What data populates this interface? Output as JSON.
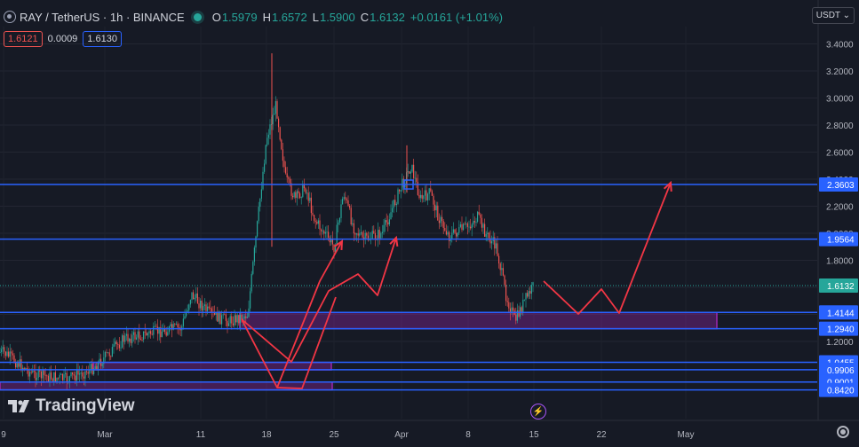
{
  "header": {
    "title": "RAY / TetherUS · 1h · BINANCE",
    "open_label": "O",
    "open": "1.5979",
    "high_label": "H",
    "high": "1.6572",
    "low_label": "L",
    "low": "1.5900",
    "close_label": "C",
    "close": "1.6132",
    "change": "+0.0161 (+1.01%)"
  },
  "trade": {
    "sell": "1.6121",
    "spread": "0.0009",
    "buy": "1.6130"
  },
  "currency": "USDT ⌄",
  "branding": "TradingView",
  "icons": {
    "symbol": "coin-icon",
    "live": "market-open-dot",
    "bolt": "lightning-icon",
    "settings": "gear-icon"
  },
  "colors": {
    "up": "#26a69a",
    "down": "#ef5350",
    "level": "#2962ff",
    "zone": "#9c27b0",
    "arrow": "#f23645",
    "current": "#26a69a"
  },
  "chart_data": {
    "type": "candlestick",
    "y_ticks": [
      "3.4000",
      "3.2000",
      "3.0000",
      "2.8000",
      "2.6000",
      "2.4000",
      "2.2000",
      "2.0000",
      "1.8000",
      "1.6000",
      "1.4000",
      "1.2000"
    ],
    "x_ticks": [
      "9",
      "Mar",
      "11",
      "18",
      "25",
      "Apr",
      "8",
      "15",
      "22",
      "May"
    ],
    "levels": [
      "2.3603",
      "1.9564",
      "1.4144",
      "1.2940",
      "1.0455",
      "0.9906",
      "0.9001",
      "0.8420"
    ],
    "current_price": "1.6132",
    "ylim": [
      0.8,
      3.45
    ],
    "zones": [
      {
        "from_idx": 270,
        "to_idx": 807,
        "low": 1.294,
        "high": 1.4144
      },
      {
        "from_idx": 105,
        "to_idx": 373,
        "low": 0.99,
        "high": 1.045
      },
      {
        "from_idx": 0,
        "to_idx": 374,
        "low": 0.842,
        "high": 0.9
      }
    ],
    "trend": [
      {
        "x": "2024-02-09",
        "y": 1.12
      },
      {
        "x": "2024-02-15",
        "y": 0.96
      },
      {
        "x": "2024-02-22",
        "y": 0.92
      },
      {
        "x": "2024-02-27",
        "y": 0.99
      },
      {
        "x": "2024-03-01",
        "y": 1.08
      },
      {
        "x": "2024-03-03",
        "y": 1.22
      },
      {
        "x": "2024-03-07",
        "y": 1.28
      },
      {
        "x": "2024-03-09",
        "y": 1.3
      },
      {
        "x": "2024-03-10",
        "y": 1.55
      },
      {
        "x": "2024-03-12",
        "y": 1.4
      },
      {
        "x": "2024-03-14",
        "y": 1.35
      },
      {
        "x": "2024-03-16",
        "y": 1.4
      },
      {
        "x": "2024-03-17",
        "y": 2.05
      },
      {
        "x": "2024-03-18",
        "y": 2.7
      },
      {
        "x": "2024-03-19",
        "y": 2.95
      },
      {
        "x": "2024-03-20",
        "y": 2.4
      },
      {
        "x": "2024-03-21",
        "y": 2.25
      },
      {
        "x": "2024-03-22",
        "y": 2.35
      },
      {
        "x": "2024-03-23",
        "y": 2.1
      },
      {
        "x": "2024-03-25",
        "y": 1.9
      },
      {
        "x": "2024-03-26",
        "y": 2.3
      },
      {
        "x": "2024-03-27",
        "y": 2.05
      },
      {
        "x": "2024-03-28",
        "y": 1.95
      },
      {
        "x": "2024-03-30",
        "y": 2.0
      },
      {
        "x": "2024-04-01",
        "y": 2.35
      },
      {
        "x": "2024-04-02",
        "y": 2.5
      },
      {
        "x": "2024-04-03",
        "y": 2.25
      },
      {
        "x": "2024-04-04",
        "y": 2.3
      },
      {
        "x": "2024-04-05",
        "y": 2.1
      },
      {
        "x": "2024-04-06",
        "y": 1.98
      },
      {
        "x": "2024-04-08",
        "y": 2.05
      },
      {
        "x": "2024-04-09",
        "y": 2.12
      },
      {
        "x": "2024-04-10",
        "y": 1.98
      },
      {
        "x": "2024-04-11",
        "y": 1.9
      },
      {
        "x": "2024-04-12",
        "y": 1.55
      },
      {
        "x": "2024-04-13",
        "y": 1.35
      },
      {
        "x": "2024-04-14",
        "y": 1.5
      },
      {
        "x": "2024-04-15",
        "y": 1.61
      }
    ],
    "projection_paths": [
      [
        [
          272,
          360
        ],
        [
          312,
          437
        ],
        [
          360,
          317
        ],
        [
          385,
          272
        ]
      ],
      [
        [
          272,
          360
        ],
        [
          328,
          408
        ],
        [
          370,
          328
        ],
        [
          403,
          309
        ],
        [
          425,
          333
        ],
        [
          446,
          268
        ]
      ],
      [
        [
          312,
          437
        ],
        [
          340,
          438
        ],
        [
          378,
          335
        ]
      ],
      [
        [
          612,
          317
        ],
        [
          651,
          354
        ],
        [
          677,
          326
        ],
        [
          697,
          353
        ],
        [
          755,
          206
        ]
      ]
    ]
  }
}
